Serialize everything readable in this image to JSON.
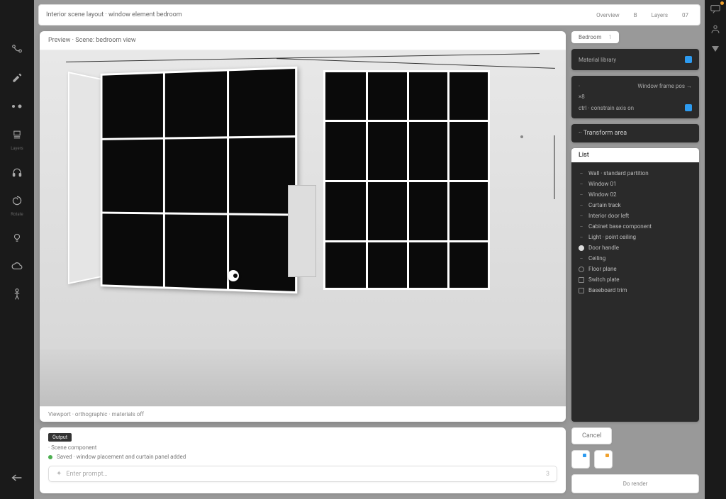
{
  "topbar": {
    "title": "Interior scene layout · window element bedroom",
    "right": [
      "Overview",
      "B",
      "Layers",
      "07"
    ]
  },
  "sidebar_icons": [
    {
      "name": "node-icon"
    },
    {
      "name": "eyedropper-icon"
    },
    {
      "name": "dots-icon"
    },
    {
      "name": "layer-icon",
      "label": "Layers"
    },
    {
      "name": "headphones-icon"
    },
    {
      "name": "spiral-icon",
      "label": "Rotate"
    },
    {
      "name": "bulb-icon"
    },
    {
      "name": "cloud-icon"
    },
    {
      "name": "figure-icon"
    },
    {
      "name": "arrow-left-icon"
    }
  ],
  "viewport": {
    "header": "Preview · Scene: bedroom view",
    "footer": "Viewport · orthographic · materials off"
  },
  "right": {
    "tag": "Bedroom",
    "tag_count": "1",
    "card1": {
      "title": "Material library",
      "accent": true
    },
    "card2": {
      "row1_label": "·",
      "row1_text": "Window frame pos →",
      "row2_label": "×8",
      "row3_text": "ctrl · constrain axis on",
      "row3_accent": true
    },
    "card3": {
      "head": "·· Transform area"
    },
    "list_tab": "List",
    "items": [
      {
        "icon": "dash",
        "label": "Wall · standard partition"
      },
      {
        "icon": "dash",
        "label": "Window 01"
      },
      {
        "icon": "dash",
        "label": "Window 02"
      },
      {
        "icon": "dash",
        "label": "Curtain track"
      },
      {
        "icon": "dash",
        "label": "Interior door left"
      },
      {
        "icon": "dash",
        "label": "Cabinet base component"
      },
      {
        "icon": "dash",
        "label": "Light · point ceiling"
      },
      {
        "icon": "circle-filled",
        "label": "Door handle"
      },
      {
        "icon": "dash",
        "label": "Ceiling"
      },
      {
        "icon": "circle",
        "label": "Floor plane"
      },
      {
        "icon": "box",
        "label": "Switch plate"
      },
      {
        "icon": "box",
        "label": "Baseboard trim"
      }
    ]
  },
  "console": {
    "tag": "Output",
    "line1": "· Scene component",
    "line2": "Saved · window placement and curtain panel added",
    "placeholder": "Enter prompt…",
    "count": "3"
  },
  "controls": {
    "cancel": "Cancel",
    "render": "Do render"
  },
  "far_right": [
    {
      "name": "message-icon"
    },
    {
      "name": "user-icon"
    },
    {
      "name": "triangle-down-icon"
    }
  ]
}
